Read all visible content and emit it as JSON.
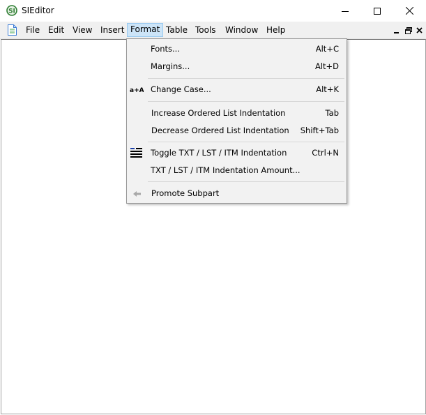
{
  "window": {
    "title": "SIEditor",
    "app_icon": "sieditor-logo-icon",
    "controls": [
      "minimize-icon",
      "maximize-icon",
      "close-icon"
    ]
  },
  "menubar": {
    "doc_icon": "document-icon",
    "items": [
      {
        "label": "File"
      },
      {
        "label": "Edit"
      },
      {
        "label": "View"
      },
      {
        "label": "Insert"
      },
      {
        "label": "Format",
        "active": true
      },
      {
        "label": "Table"
      },
      {
        "label": "Tools"
      },
      {
        "label": "Window"
      },
      {
        "label": "Help"
      }
    ],
    "mdi_controls": [
      "mdi-minimize-icon",
      "mdi-restore-icon",
      "mdi-close-icon"
    ]
  },
  "format_menu": {
    "items": [
      {
        "label": "Fonts...",
        "shortcut": "Alt+C"
      },
      {
        "label": "Margins...",
        "shortcut": "Alt+D"
      },
      {
        "label": "Change Case...",
        "shortcut": "Alt+K",
        "icon": "change-case-icon",
        "icon_text": "a+A"
      },
      {
        "label": "Increase Ordered List Indentation",
        "shortcut": "Tab"
      },
      {
        "label": "Decrease Ordered List Indentation",
        "shortcut": "Shift+Tab"
      },
      {
        "label": "Toggle TXT / LST / ITM Indentation",
        "shortcut": "Ctrl+N",
        "icon": "toggle-indentation-icon"
      },
      {
        "label": "TXT / LST / ITM Indentation Amount...",
        "shortcut": ""
      },
      {
        "label": "Promote Subpart",
        "shortcut": "",
        "icon": "promote-arrow-icon"
      }
    ]
  },
  "colors": {
    "menu_highlight": "#cce4f7",
    "menu_highlight_border": "#99c9ef",
    "app_icon_green": "#2e7d32"
  }
}
